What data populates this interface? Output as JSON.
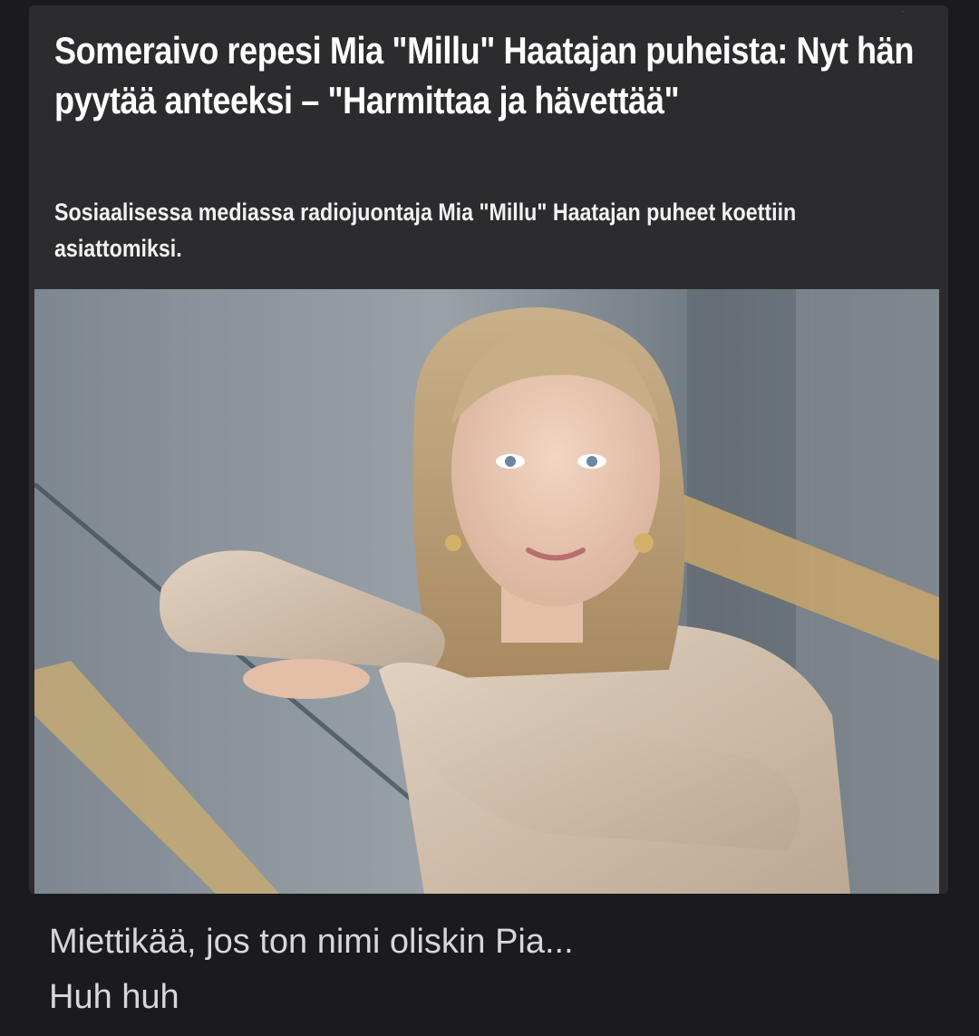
{
  "article": {
    "headline": "Someraivo repesi Mia \"Millu\" Haatajan puheista: Nyt hän pyytää anteeksi – \"Harmittaa ja hävettää\"",
    "lead": "Sosiaalisessa mediassa radiojuontaja Mia \"Millu\" Haatajan puheet koettiin asiattomiksi."
  },
  "comment": {
    "line1": "Miettikää, jos ton nimi oliskin Pia...",
    "line2": "Huh huh"
  },
  "colors": {
    "background": "#1b1b1d",
    "card": "#2c2c2e",
    "headline_text": "#ffffff",
    "comment_text": "#d7d7d9"
  }
}
